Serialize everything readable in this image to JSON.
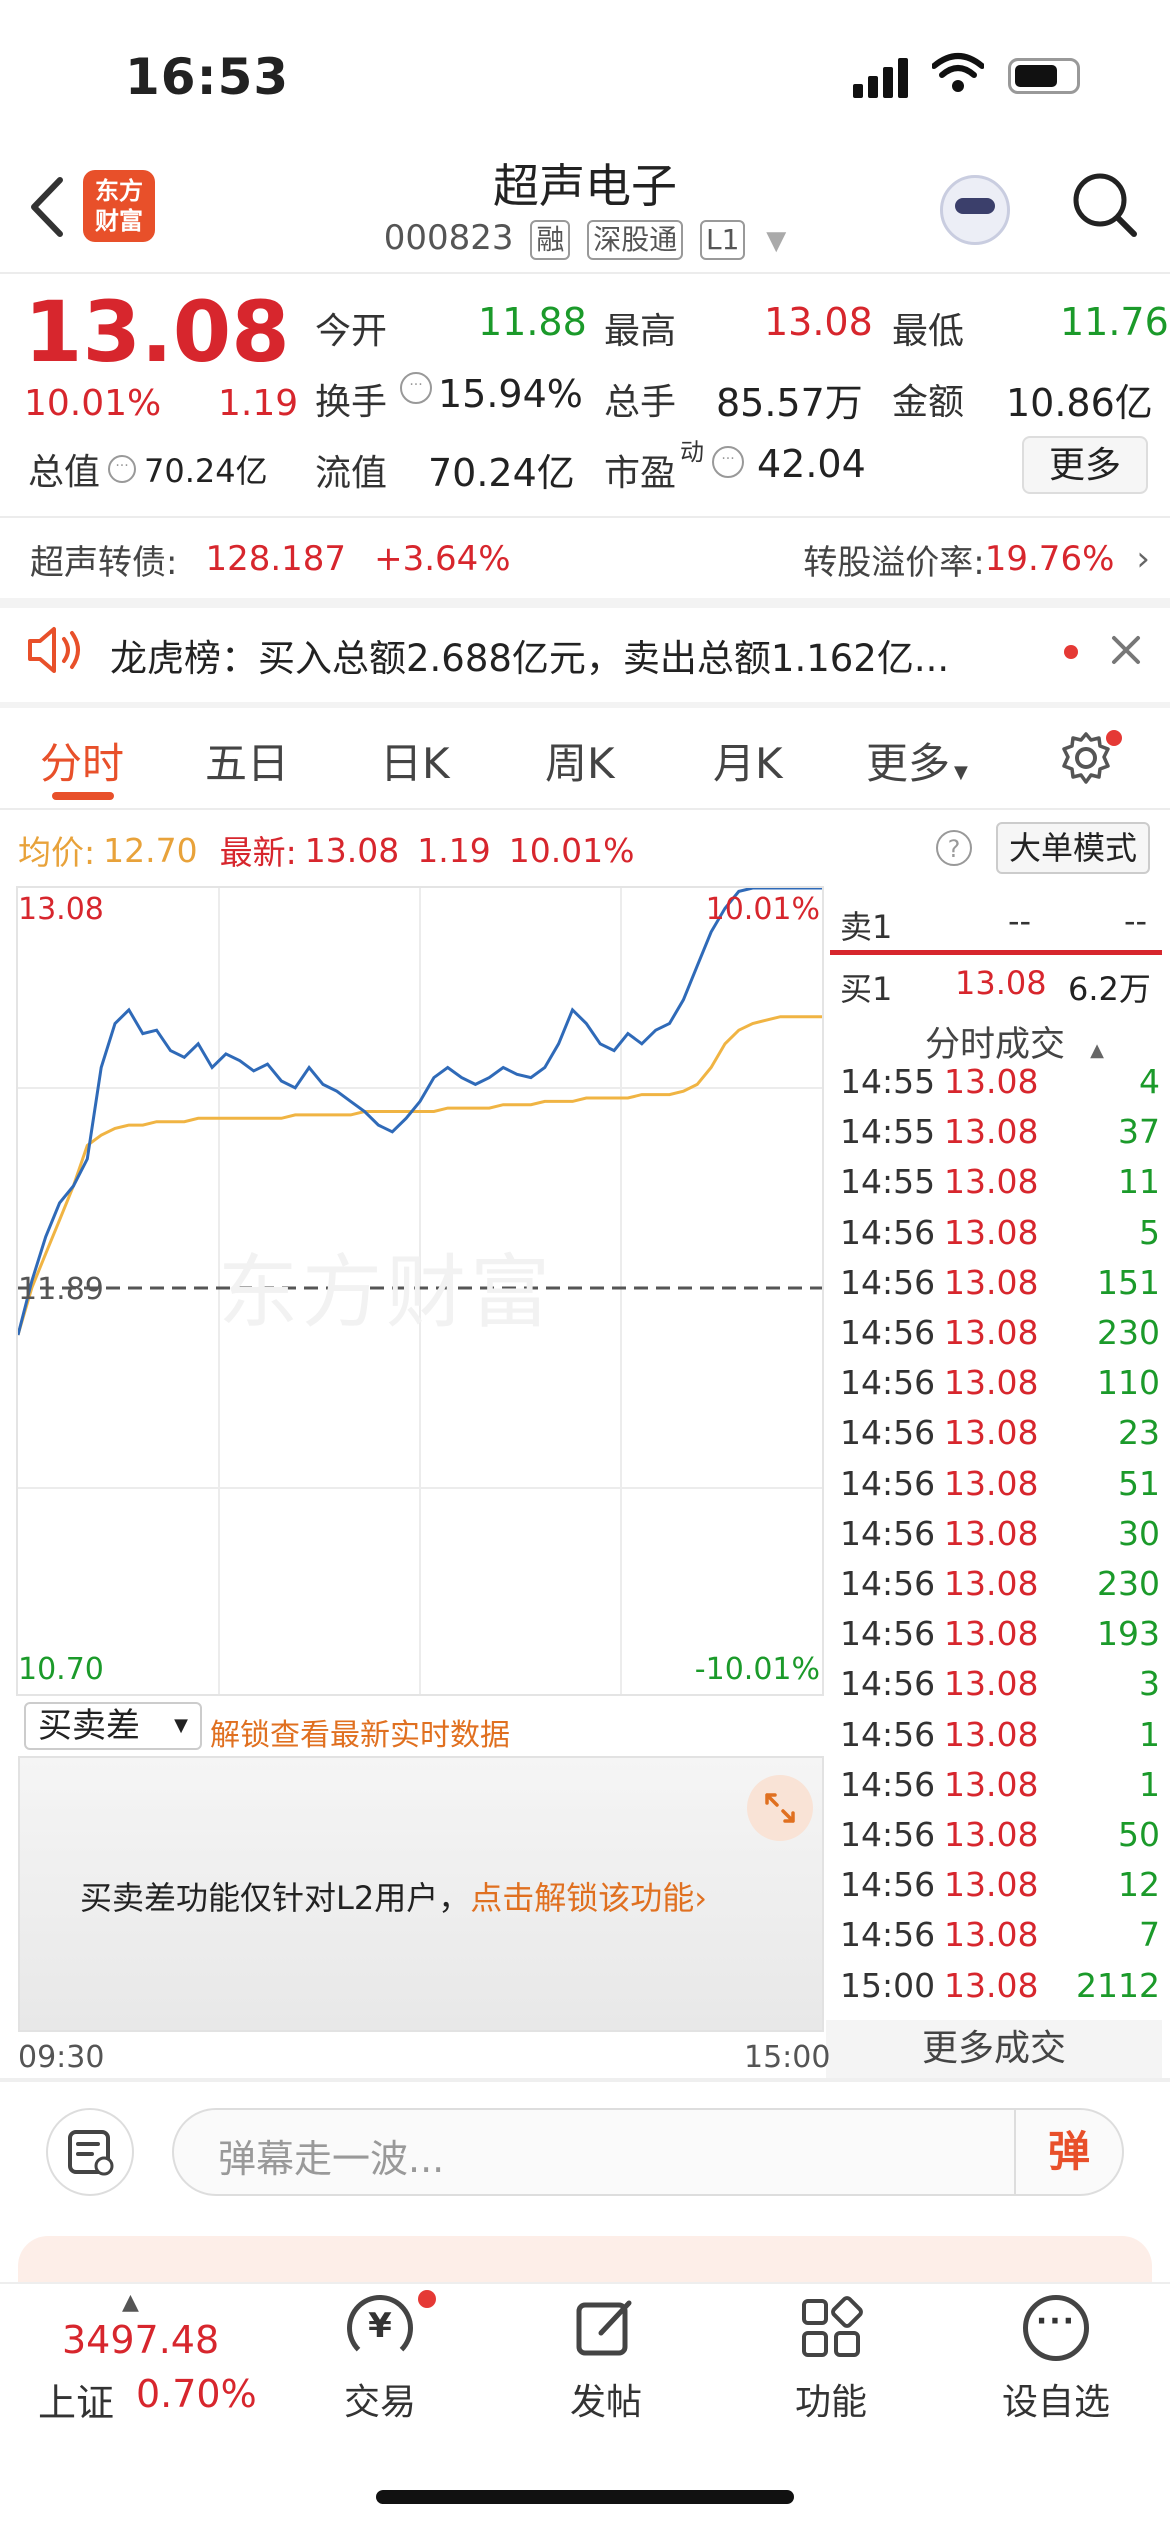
{
  "status_bar": {
    "time": "16:53"
  },
  "header": {
    "title": "超声电子",
    "code": "000823",
    "tags": [
      "融",
      "深股通",
      "L1"
    ],
    "logo_text": [
      "东方",
      "财富"
    ]
  },
  "quote": {
    "price": "13.08",
    "change_pct": "10.01%",
    "change": "1.19",
    "open_label": "今开",
    "open": "11.88",
    "high_label": "最高",
    "high": "13.08",
    "low_label": "最低",
    "low": "11.76",
    "turnover_label": "换手",
    "turnover": "15.94%",
    "volume_label": "总手",
    "volume": "85.57万",
    "amount_label": "金额",
    "amount": "10.86亿",
    "mktcap_label": "总值",
    "mktcap": "70.24亿",
    "float_label": "流值",
    "float": "70.24亿",
    "pe_label": "市盈",
    "pe_sup": "动",
    "pe": "42.04",
    "more": "更多"
  },
  "bond": {
    "label": "超声转债:",
    "price": "128.187",
    "change": "+3.64%",
    "premium_label": "转股溢价率:",
    "premium": "19.76%"
  },
  "notice": {
    "text": "龙虎榜：买入总额2.688亿元，卖出总额1.162亿..."
  },
  "tabs": [
    "分时",
    "五日",
    "日K",
    "周K",
    "月K",
    "更多"
  ],
  "info_bar": {
    "avg_label": "均价:",
    "avg": "12.70",
    "latest_label": "最新:",
    "latest": "13.08",
    "chg": "1.19",
    "pct": "10.01%",
    "mode": "大单模式"
  },
  "chart_data": {
    "type": "line",
    "y_top_label": "13.08",
    "y_bottom_label": "10.70",
    "y_mid_label": "11.89",
    "pct_top_label": "10.01%",
    "pct_bottom_label": "-10.01%",
    "x_start": "09:30",
    "x_end": "15:00",
    "ylim": [
      10.7,
      13.08
    ],
    "prev_close": 11.89,
    "series": [
      {
        "name": "",
        "values": [
          11.76,
          11.92,
          12.05,
          12.15,
          12.2,
          12.28,
          12.55,
          12.68,
          12.72,
          12.65,
          12.66,
          12.6,
          12.58,
          12.62,
          12.55,
          12.59,
          12.57,
          12.54,
          12.56,
          12.51,
          12.49,
          12.55,
          12.5,
          12.48,
          12.45,
          12.42,
          12.38,
          12.36,
          12.4,
          12.45,
          12.52,
          12.55,
          12.52,
          12.5,
          12.52,
          12.55,
          12.53,
          12.52,
          12.55,
          12.62,
          12.72,
          12.68,
          12.62,
          12.6,
          12.65,
          12.62,
          12.66,
          12.68,
          12.75,
          12.85,
          12.95,
          13.02,
          13.07,
          13.08,
          13.08,
          13.08,
          13.08,
          13.08,
          13.08
        ]
      },
      {
        "name": "均价",
        "values": [
          11.76,
          11.9,
          12.0,
          12.1,
          12.2,
          12.32,
          12.35,
          12.37,
          12.38,
          12.38,
          12.39,
          12.39,
          12.39,
          12.4,
          12.4,
          12.4,
          12.4,
          12.4,
          12.4,
          12.4,
          12.41,
          12.41,
          12.41,
          12.41,
          12.41,
          12.42,
          12.42,
          12.42,
          12.42,
          12.42,
          12.42,
          12.43,
          12.43,
          12.43,
          12.43,
          12.44,
          12.44,
          12.44,
          12.45,
          12.45,
          12.45,
          12.46,
          12.46,
          12.46,
          12.46,
          12.47,
          12.47,
          12.47,
          12.48,
          12.5,
          12.55,
          12.62,
          12.66,
          12.68,
          12.69,
          12.7,
          12.7,
          12.7,
          12.7
        ]
      }
    ]
  },
  "orderbook": {
    "sell_label": "卖1",
    "sell_price": "--",
    "sell_vol": "--",
    "buy_label": "买1",
    "buy_price": "13.08",
    "buy_vol": "6.2万"
  },
  "trades_header": "分时成交",
  "trades": [
    {
      "t": "14:55",
      "p": "13.08",
      "v": "4"
    },
    {
      "t": "14:55",
      "p": "13.08",
      "v": "37"
    },
    {
      "t": "14:55",
      "p": "13.08",
      "v": "11"
    },
    {
      "t": "14:56",
      "p": "13.08",
      "v": "5"
    },
    {
      "t": "14:56",
      "p": "13.08",
      "v": "151"
    },
    {
      "t": "14:56",
      "p": "13.08",
      "v": "230"
    },
    {
      "t": "14:56",
      "p": "13.08",
      "v": "110"
    },
    {
      "t": "14:56",
      "p": "13.08",
      "v": "23"
    },
    {
      "t": "14:56",
      "p": "13.08",
      "v": "51"
    },
    {
      "t": "14:56",
      "p": "13.08",
      "v": "30"
    },
    {
      "t": "14:56",
      "p": "13.08",
      "v": "230"
    },
    {
      "t": "14:56",
      "p": "13.08",
      "v": "193"
    },
    {
      "t": "14:56",
      "p": "13.08",
      "v": "3"
    },
    {
      "t": "14:56",
      "p": "13.08",
      "v": "1"
    },
    {
      "t": "14:56",
      "p": "13.08",
      "v": "1"
    },
    {
      "t": "14:56",
      "p": "13.08",
      "v": "50"
    },
    {
      "t": "14:56",
      "p": "13.08",
      "v": "12"
    },
    {
      "t": "14:56",
      "p": "13.08",
      "v": "7"
    },
    {
      "t": "15:00",
      "p": "13.08",
      "v": "2112"
    }
  ],
  "more_trades": "更多成交",
  "spread": {
    "select": "买卖差",
    "unlock_hint": "解锁查看最新实时数据",
    "msg": "买卖差功能仅针对L2用户，",
    "msg_link": "点击解锁该功能",
    "msg_arrow": "›"
  },
  "danmaku": {
    "placeholder": "弹幕走一波...",
    "send": "弹"
  },
  "index": {
    "value": "3497.48",
    "name": "上证",
    "pct": "0.70%"
  },
  "nav": [
    "交易",
    "发帖",
    "功能",
    "设自选"
  ],
  "watermark": "东方财富"
}
